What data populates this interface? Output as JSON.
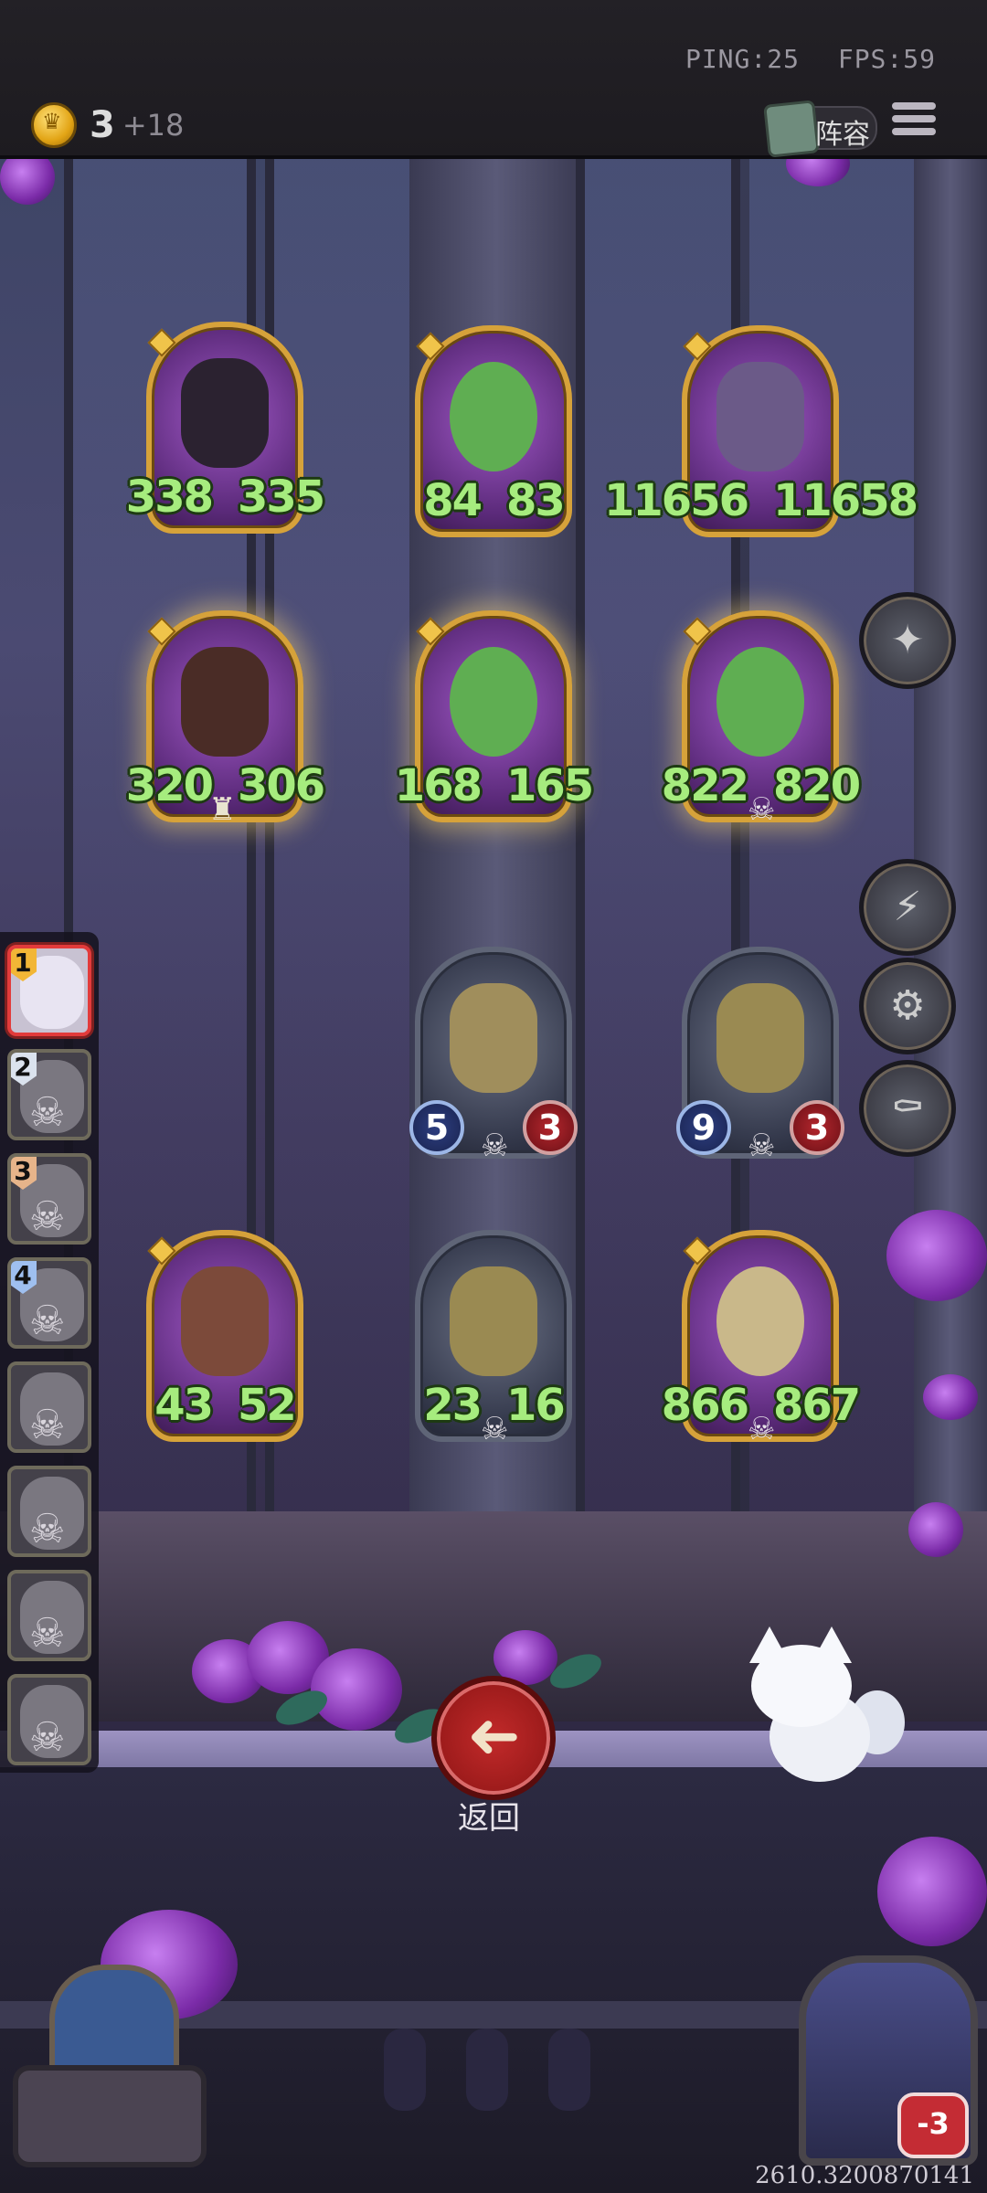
{
  "top_bar": {
    "ping": "PING:25",
    "fps": "FPS:59",
    "coins": "3",
    "coin_income": "+18",
    "lineup_label": "阵容"
  },
  "opponent_board": [
    {
      "attack": "338",
      "health": "335",
      "frame": "gold"
    },
    {
      "attack": "84",
      "health": "83",
      "frame": "gold"
    },
    {
      "attack": "11656",
      "health": "11658",
      "frame": "gold"
    },
    {
      "attack": "320",
      "health": "306",
      "frame": "gold"
    },
    {
      "attack": "168",
      "health": "165",
      "frame": "gold"
    },
    {
      "attack": "822",
      "health": "820",
      "frame": "gold"
    }
  ],
  "player_board": [
    {
      "attack": "5",
      "health": "3",
      "frame": "silver"
    },
    {
      "attack": "9",
      "health": "3",
      "frame": "silver"
    },
    {
      "attack": "43",
      "health": "52",
      "frame": "gold"
    },
    {
      "attack": "23",
      "health": "16",
      "frame": "silver"
    },
    {
      "attack": "866",
      "health": "867",
      "frame": "gold"
    }
  ],
  "leaderboard": [
    {
      "rank": "1",
      "active": true,
      "eliminated": false
    },
    {
      "rank": "2",
      "active": false,
      "eliminated": true
    },
    {
      "rank": "3",
      "active": false,
      "eliminated": true
    },
    {
      "rank": "4",
      "active": false,
      "eliminated": true
    },
    {
      "rank": "",
      "active": false,
      "eliminated": true
    },
    {
      "rank": "",
      "active": false,
      "eliminated": true
    },
    {
      "rank": "",
      "active": false,
      "eliminated": true
    },
    {
      "rank": "",
      "active": false,
      "eliminated": true
    }
  ],
  "back_button": {
    "label": "返回"
  },
  "player": {
    "health_change": "-3"
  },
  "footer_code": "2610.3200870141",
  "colors": {
    "stat_green": "#a6ec7e",
    "gold_frame": "#d6a23a",
    "active_rank": "#e23b3b",
    "back_red": "#c22a2a"
  }
}
